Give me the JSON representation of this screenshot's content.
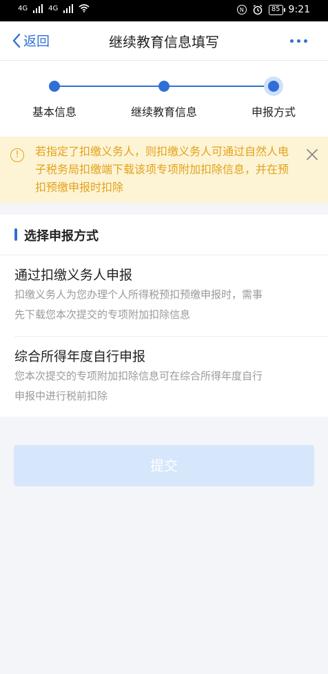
{
  "status_bar": {
    "signal_1": "4G",
    "signal_2": "4G",
    "nfc": "N",
    "battery": "85",
    "time": "9:21"
  },
  "nav": {
    "back_label": "返回",
    "title": "继续教育信息填写"
  },
  "steps": [
    {
      "label": "基本信息"
    },
    {
      "label": "继续教育信息"
    },
    {
      "label": "申报方式"
    }
  ],
  "notice": {
    "icon_text": "!",
    "text": "若指定了扣缴义务人，则扣缴义务人可通过自然人电子税务局扣缴端下载该项专项附加扣除信息，并在预扣预缴申报时扣除"
  },
  "section": {
    "title": "选择申报方式",
    "options": [
      {
        "title": "通过扣缴义务人申报",
        "desc": "扣缴义务人为您办理个人所得税预扣预缴申报时，需事先下载您本次提交的专项附加扣除信息"
      },
      {
        "title": "综合所得年度自行申报",
        "desc": "您本次提交的专项附加扣除信息可在综合所得年度自行申报中进行税前扣除"
      }
    ]
  },
  "submit_label": "提交",
  "colors": {
    "accent": "#2f6fd6",
    "notice_bg": "#fdf4d6",
    "notice_text": "#e3a21a",
    "submit_disabled": "#d6e6fb"
  }
}
